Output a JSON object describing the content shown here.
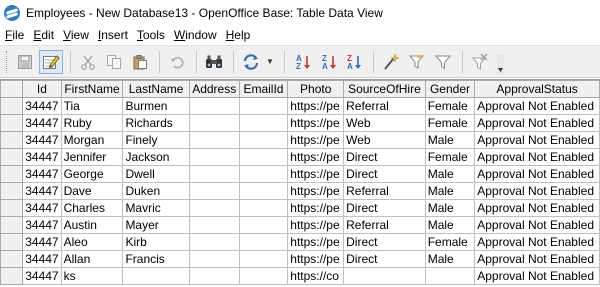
{
  "window": {
    "title": "Employees - New Database13 - OpenOffice Base: Table Data View"
  },
  "menu": [
    {
      "label": "File",
      "mnemonic": "F",
      "rest": "ile"
    },
    {
      "label": "Edit",
      "mnemonic": "E",
      "rest": "dit"
    },
    {
      "label": "View",
      "mnemonic": "V",
      "rest": "iew"
    },
    {
      "label": "Insert",
      "mnemonic": "I",
      "rest": "nsert"
    },
    {
      "label": "Tools",
      "mnemonic": "T",
      "rest": "ools"
    },
    {
      "label": "Window",
      "mnemonic": "W",
      "rest": "indow"
    },
    {
      "label": "Help",
      "mnemonic": "H",
      "rest": "elp"
    }
  ],
  "toolbar": {
    "buttons": [
      "save-icon",
      "edit-data-icon",
      "cut-icon",
      "copy-icon",
      "paste-icon",
      "undo-icon",
      "find-icon",
      "refresh-icon",
      "sort-ascending-icon",
      "sort-descending-icon",
      "sort-icon",
      "autofilter-icon",
      "standard-filter-icon",
      "filter-icon",
      "remove-filter-icon"
    ]
  },
  "table": {
    "columns": [
      "Id",
      "FirstName",
      "LastName",
      "Address",
      "EmailId",
      "Photo",
      "SourceOfHire",
      "Gender",
      "ApprovalStatus"
    ],
    "rows": [
      [
        "34447",
        "Tia",
        "Burmen",
        "",
        "",
        "https://pe",
        "Referral",
        "Female",
        "Approval Not Enabled"
      ],
      [
        "34447",
        "Ruby",
        "Richards",
        "",
        "",
        "https://pe",
        "Web",
        "Female",
        "Approval Not Enabled"
      ],
      [
        "34447",
        "Morgan",
        "Finely",
        "",
        "",
        "https://pe",
        "Web",
        "Male",
        "Approval Not Enabled"
      ],
      [
        "34447",
        "Jennifer",
        "Jackson",
        "",
        "",
        "https://pe",
        "Direct",
        "Female",
        "Approval Not Enabled"
      ],
      [
        "34447",
        "George",
        "Dwell",
        "",
        "",
        "https://pe",
        "Direct",
        "Male",
        "Approval Not Enabled"
      ],
      [
        "34447",
        "Dave",
        "Duken",
        "",
        "",
        "https://pe",
        "Referral",
        "Male",
        "Approval Not Enabled"
      ],
      [
        "34447",
        "Charles",
        "Mavric",
        "",
        "",
        "https://pe",
        "Direct",
        "Male",
        "Approval Not Enabled"
      ],
      [
        "34447",
        "Austin",
        "Mayer",
        "",
        "",
        "https://pe",
        "Referral",
        "Male",
        "Approval Not Enabled"
      ],
      [
        "34447",
        "Aleo",
        "Kirb",
        "",
        "",
        "https://pe",
        "Direct",
        "Female",
        "Approval Not Enabled"
      ],
      [
        "34447",
        "Allan",
        "Francis",
        "",
        "",
        "https://pe",
        "Direct",
        "Male",
        "Approval Not Enabled"
      ],
      [
        "34447",
        "ks",
        "",
        "",
        "",
        "https://co",
        "",
        "",
        "Approval Not Enabled"
      ]
    ]
  },
  "colors": {
    "toolbar_bg": "#f0f0f0",
    "header_bg": "#f0f0f0",
    "grid_line": "#c0c0c0",
    "app_icon": "#2a7ccb"
  }
}
